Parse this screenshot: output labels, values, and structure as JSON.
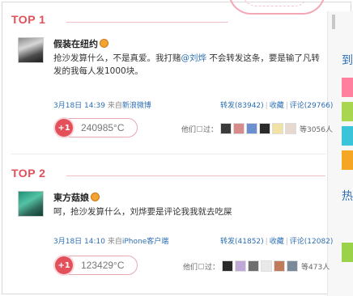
{
  "posts": [
    {
      "rank": "TOP 1",
      "username": "假装在纽约",
      "text_before_mention": "抢沙发算什么，不是真爱。我打赌",
      "mention": "@刘烨",
      "text_after_mention": " 不会转发这条，要是输了凡转发的我每人发1000块。",
      "date": "3月18日 14:39",
      "source_prefix": "来自",
      "source": "新浪微博",
      "repost_label": "转发(83942)",
      "fav_label": "收藏",
      "comment_label": "评论(29766)",
      "vote": "+1",
      "temperature": "240985°C",
      "visitors_label": "他们",
      "visitors_suffix": "过：",
      "visitor_count": "等3056人"
    },
    {
      "rank": "TOP 2",
      "username": "東方菇娘",
      "text_before_mention": "呵，抢沙发算什么，刘烨要是评论我我就去吃屎",
      "mention": "",
      "text_after_mention": "",
      "date": "3月18日 14:10",
      "source_prefix": "来自",
      "source": "iPhone客户端",
      "repost_label": "转发(41852)",
      "fav_label": "收藏",
      "comment_label": "评论(12082)",
      "vote": "+1",
      "temperature": "123429°C",
      "visitors_label": "他们",
      "visitors_suffix": "过：",
      "visitor_count": "等473人"
    }
  ],
  "sidebar": {
    "chars": [
      "到",
      "热"
    ]
  },
  "colors": {
    "accent": "#e3505a",
    "link": "#2d6fb3",
    "sidebar_tabs": [
      "#ff7f9e",
      "#a8d64e",
      "#39c4d9",
      "#f5a623",
      "#9ad24a"
    ],
    "visitors_1": [
      "#3b3b3b",
      "#d98a8a",
      "#6b8fd1",
      "#2b2b2b",
      "#f3e2a6",
      "#e7d9d0"
    ],
    "visitors_2": [
      "#2a2a2a",
      "#bfa8d8",
      "#6f6f6f",
      "#e9e9e9",
      "#c27b5a",
      "#7a8a9a"
    ]
  }
}
